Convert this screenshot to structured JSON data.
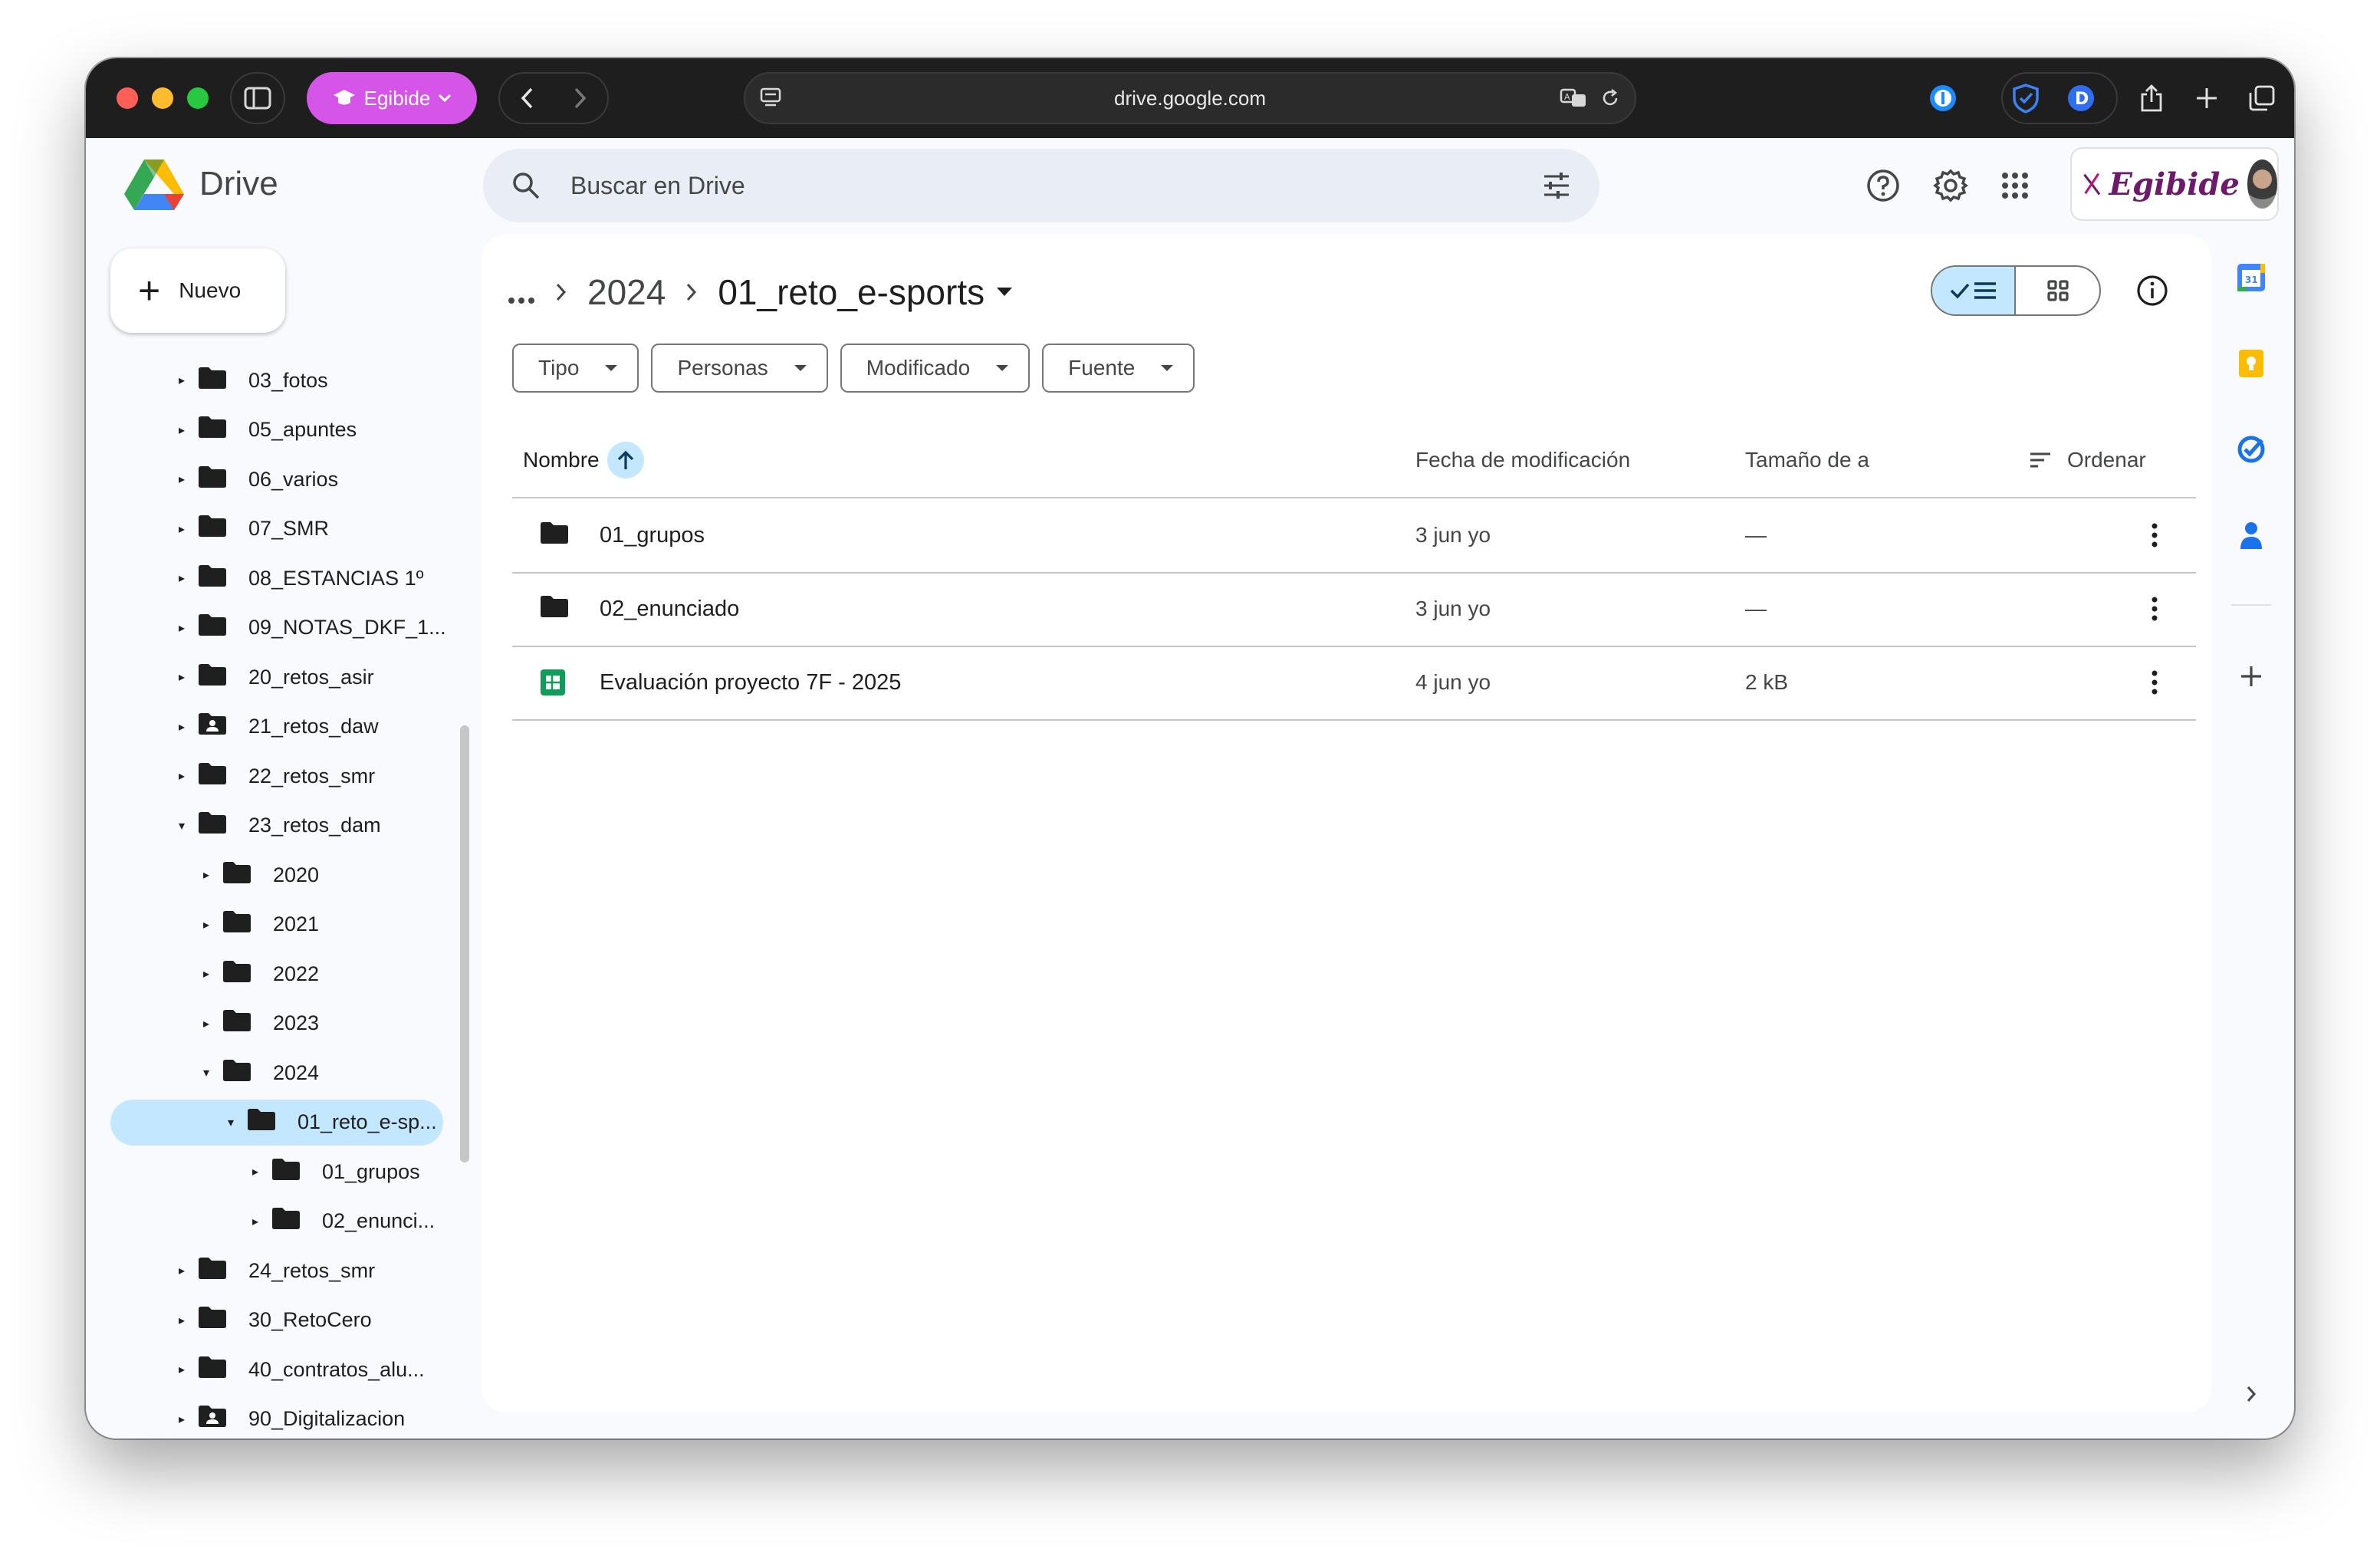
{
  "browser": {
    "profile_label": "Egibide",
    "url": "drive.google.com"
  },
  "app": {
    "name": "Drive",
    "search_placeholder": "Buscar en Drive",
    "org_name": "Egibide",
    "new_button_label": "Nuevo"
  },
  "sidebar": {
    "items": [
      {
        "label": "03_fotos",
        "level": 0,
        "expanded": false,
        "shared": false
      },
      {
        "label": "05_apuntes",
        "level": 0,
        "expanded": false,
        "shared": false
      },
      {
        "label": "06_varios",
        "level": 0,
        "expanded": false,
        "shared": false
      },
      {
        "label": "07_SMR",
        "level": 0,
        "expanded": false,
        "shared": false
      },
      {
        "label": "08_ESTANCIAS 1º",
        "level": 0,
        "expanded": false,
        "shared": false
      },
      {
        "label": "09_NOTAS_DKF_1...",
        "level": 0,
        "expanded": false,
        "shared": false
      },
      {
        "label": "20_retos_asir",
        "level": 0,
        "expanded": false,
        "shared": false
      },
      {
        "label": "21_retos_daw",
        "level": 0,
        "expanded": false,
        "shared": true
      },
      {
        "label": "22_retos_smr",
        "level": 0,
        "expanded": false,
        "shared": false
      },
      {
        "label": "23_retos_dam",
        "level": 0,
        "expanded": true,
        "shared": false
      },
      {
        "label": "2020",
        "level": 1,
        "expanded": false,
        "shared": false
      },
      {
        "label": "2021",
        "level": 1,
        "expanded": false,
        "shared": false
      },
      {
        "label": "2022",
        "level": 1,
        "expanded": false,
        "shared": false
      },
      {
        "label": "2023",
        "level": 1,
        "expanded": false,
        "shared": false
      },
      {
        "label": "2024",
        "level": 1,
        "expanded": true,
        "shared": false
      },
      {
        "label": "01_reto_e-sp...",
        "level": 2,
        "expanded": true,
        "shared": false,
        "selected": true
      },
      {
        "label": "01_grupos",
        "level": 3,
        "expanded": false,
        "shared": false
      },
      {
        "label": "02_enunci...",
        "level": 3,
        "expanded": false,
        "shared": false
      },
      {
        "label": "24_retos_smr",
        "level": 0,
        "expanded": false,
        "shared": false
      },
      {
        "label": "30_RetoCero",
        "level": 0,
        "expanded": false,
        "shared": false
      },
      {
        "label": "40_contratos_alu...",
        "level": 0,
        "expanded": false,
        "shared": false
      },
      {
        "label": "90_Digitalizacion",
        "level": 0,
        "expanded": false,
        "shared": true
      }
    ]
  },
  "breadcrumb": {
    "parent": "2024",
    "current": "01_reto_e-sports"
  },
  "filters": [
    "Tipo",
    "Personas",
    "Modificado",
    "Fuente"
  ],
  "table": {
    "headers": {
      "name": "Nombre",
      "modified": "Fecha de modificación",
      "size": "Tamaño de a",
      "sort": "Ordenar"
    },
    "rows": [
      {
        "name": "01_grupos",
        "type": "folder",
        "modified": "3 jun yo",
        "size": "—"
      },
      {
        "name": "02_enunciado",
        "type": "folder",
        "modified": "3 jun yo",
        "size": "—"
      },
      {
        "name": "Evaluación proyecto 7F - 2025",
        "type": "spreadsheet",
        "modified": "4 jun yo",
        "size": "2 kB"
      }
    ]
  },
  "rail": {
    "calendar_day": "31"
  },
  "colors": {
    "selected": "#c2e7ff",
    "profile_pill": "#d455e8",
    "sheets_green": "#0f9d58"
  }
}
